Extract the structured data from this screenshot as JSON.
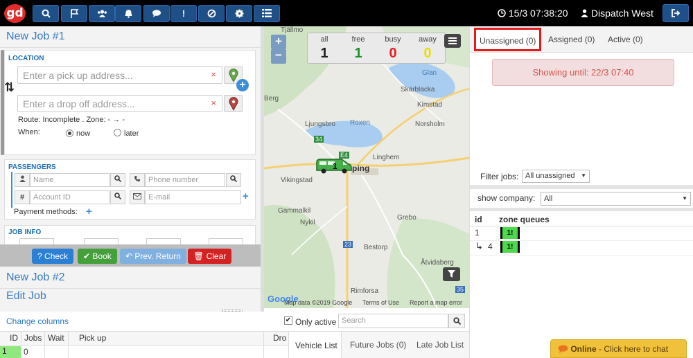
{
  "topbar": {
    "logo": "gd",
    "nav_icons": [
      "search-icon",
      "flag-icon",
      "users-icon",
      "bell-icon",
      "chat-icon",
      "alert-icon",
      "block-icon",
      "gear-icon",
      "list-icon"
    ],
    "clock": "15/3 07:38:20",
    "dispatcher": "Dispatch West",
    "logout_icon": "logout-icon"
  },
  "job_form": {
    "title": "New Job #1",
    "location_heading": "LOCATION",
    "pickup_placeholder": "Enter a pick up address...",
    "dropoff_placeholder": "Enter a drop off address...",
    "route_text": "Route: Incomplete . Zone: -",
    "route_arrow": "→",
    "route_dash": "-",
    "when_label": "When:",
    "when_options": [
      "now",
      "later"
    ],
    "when_selected": "now",
    "passengers_heading": "PASSENGERS",
    "name_placeholder": "Name",
    "phone_placeholder": "Phone number",
    "account_placeholder": "Account ID",
    "email_placeholder": "E-mail",
    "payment_label": "Payment methods:",
    "jobinfo_heading": "JOB INFO",
    "buttons": {
      "check": "Check",
      "book": "Book",
      "prev_return": "Prev. Return",
      "clear": "Clear"
    },
    "other_jobs": [
      "New Job #2",
      "Edit Job"
    ]
  },
  "map": {
    "counters": [
      {
        "label": "all",
        "value": "1",
        "color": "#222222"
      },
      {
        "label": "free",
        "value": "1",
        "color": "#1a8f2a"
      },
      {
        "label": "busy",
        "value": "0",
        "color": "#e02020"
      },
      {
        "label": "away",
        "value": "0",
        "color": "#e8e000"
      }
    ],
    "places": [
      "Tjällmo",
      "Glan",
      "Skärblacka",
      "Kimstad",
      "Norsholm",
      "Ljungsbro",
      "Roxen",
      "Linghem",
      "Vikingstad",
      "Gammalkil",
      "Nykil",
      "Grebo",
      "Bestorp",
      "Åtvidaberg",
      "Rimforsa",
      "Berg"
    ],
    "town_partial": "ping",
    "vehicle_label": "1",
    "road_labels": [
      "34",
      "E4",
      "23",
      "35"
    ],
    "google": "Google",
    "map_data": "Map data ©2019 Google",
    "terms": "Terms of Use",
    "report": "Report a map error",
    "zoom_in": "+",
    "zoom_out": "−"
  },
  "bottom": {
    "change_columns": "Change columns",
    "only_active_label": "Only active",
    "only_active_checked": true,
    "search_placeholder": "Search",
    "columns": [
      "ID",
      "Jobs",
      "Wait",
      "Pick up",
      "Drop"
    ],
    "rows": [
      {
        "id": "1",
        "jobs": "0"
      }
    ],
    "tabs": [
      "Vehicle List",
      "Future Jobs (0)",
      "Late Job List"
    ]
  },
  "right": {
    "tabs": [
      "Unassigned (0)",
      "Assigned (0)",
      "Active (0)"
    ],
    "selected_tab": "Unassigned (0)",
    "showing_until": "Showing until: 22/3 07:40",
    "filter_label": "Filter jobs:",
    "filter_value": "All unassigned",
    "company_label": "show company:",
    "company_value": "All",
    "table_head": [
      "id",
      "zone queues"
    ],
    "rows": [
      {
        "prefix": "",
        "id": "1",
        "badge": "1!"
      },
      {
        "prefix": "↳",
        "id": "4",
        "badge": "1!"
      }
    ],
    "chat_status": "Online",
    "chat_text": "- Click here to chat"
  }
}
